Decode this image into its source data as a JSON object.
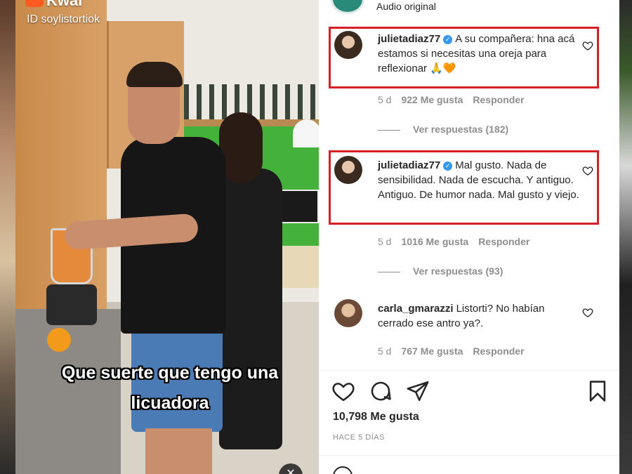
{
  "video": {
    "app_name": "Kwai",
    "creator_id": "ID soylistortiok",
    "caption_line1": "Que suerte que tengo una",
    "caption_line2": "licuadora",
    "mute_icon": "speaker-muted-icon"
  },
  "post": {
    "audio_label": "Audio original",
    "likes": "10,798 Me gusta",
    "timestamp": "HACE 5 DÍAS"
  },
  "comments": [
    {
      "user": "julietadiaz77",
      "verified": true,
      "text": "A su compañera: hna acá estamos si necesitas una oreja para reflexionar 🙏🧡",
      "age": "5 d",
      "likes": "922 Me gusta",
      "reply_label": "Responder",
      "view_replies": "Ver respuestas (182)",
      "highlighted": true
    },
    {
      "user": "julietadiaz77",
      "verified": true,
      "text": "Mal gusto. Nada de sensibilidad. Nada de escucha. Y antiguo. Antiguo. De humor nada. Mal gusto y viejo.",
      "age": "5 d",
      "likes": "1016 Me gusta",
      "reply_label": "Responder",
      "view_replies": "Ver respuestas (93)",
      "highlighted": true
    },
    {
      "user": "carla_gmarazzi",
      "verified": false,
      "text": "Listorti? No habían cerrado ese antro ya?.",
      "age": "5 d",
      "likes": "767 Me gusta",
      "reply_label": "Responder"
    }
  ],
  "colors": {
    "highlight_border": "#d81f26",
    "verified_badge": "#3897f0",
    "kwai_orange": "#ff5a1f"
  }
}
